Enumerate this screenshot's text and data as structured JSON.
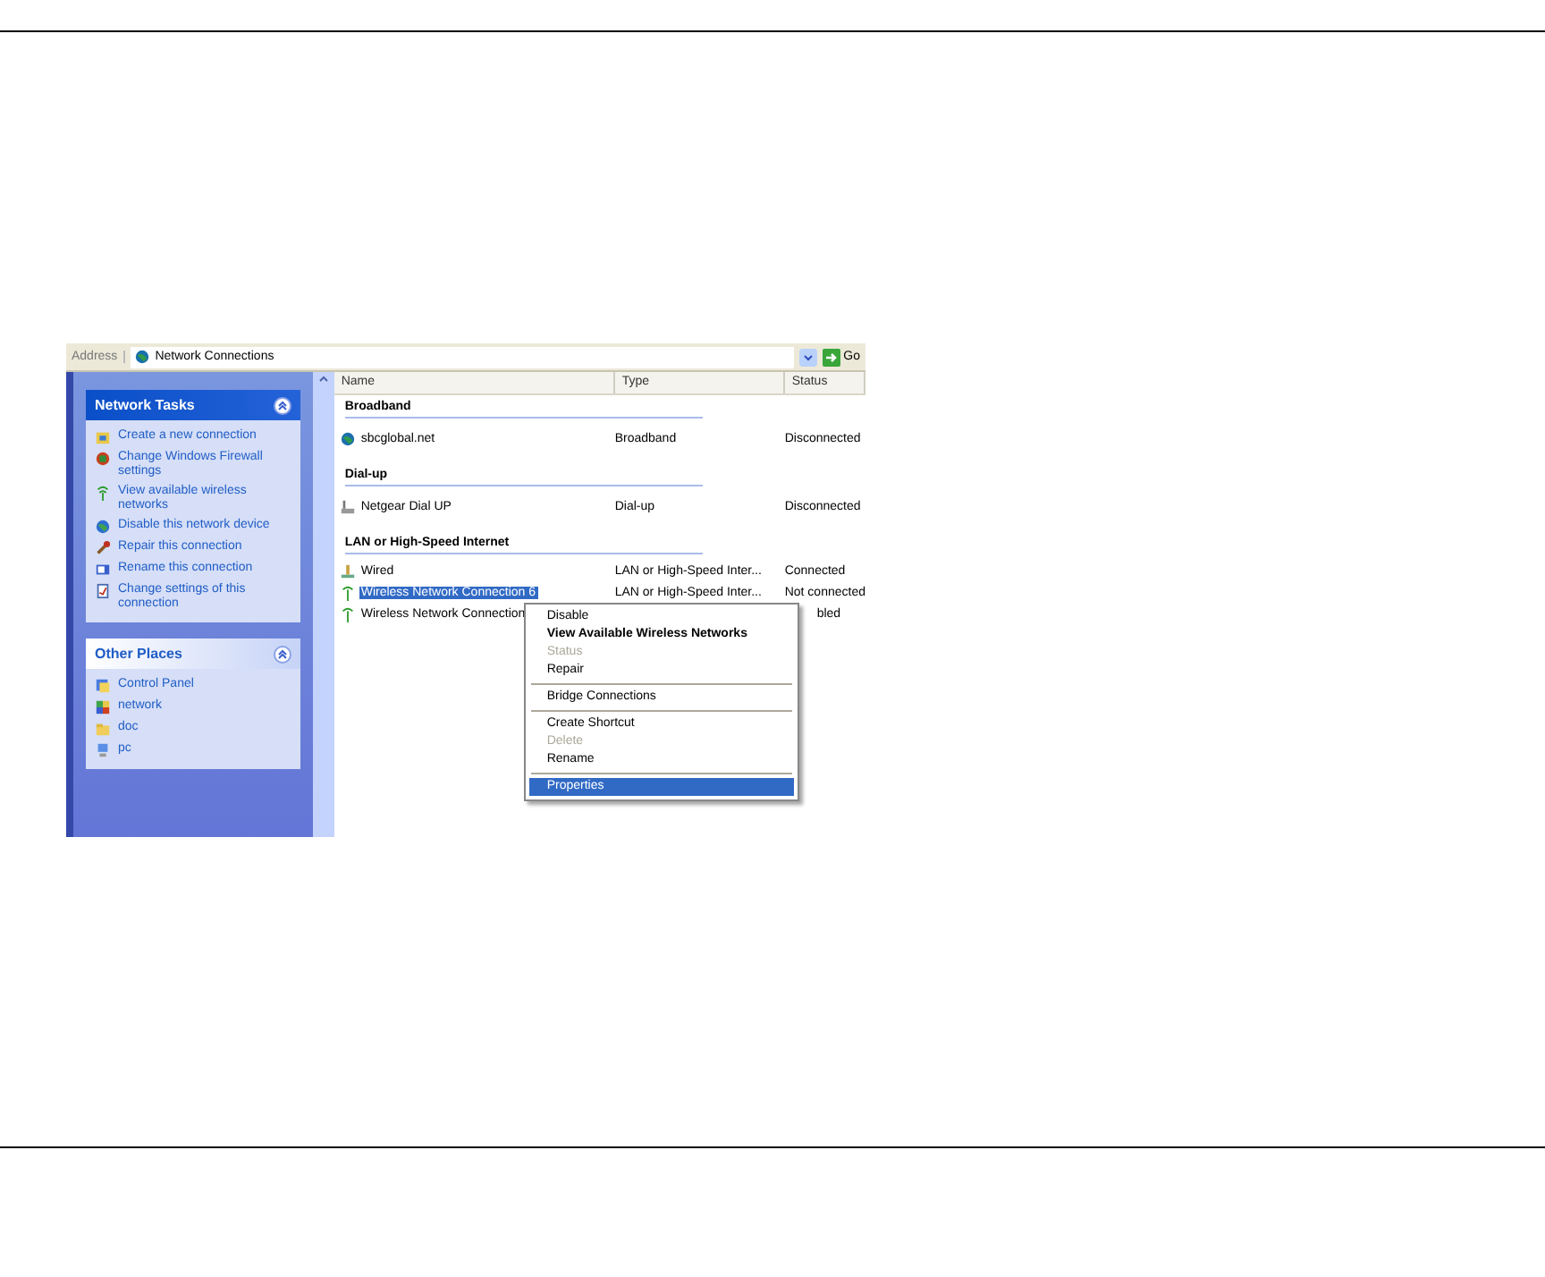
{
  "address_bar": {
    "label": "Address",
    "value": "Network Connections",
    "go": "Go"
  },
  "side_panels": [
    {
      "title": "Network Tasks",
      "items": [
        "Create a new connection",
        "Change Windows Firewall settings",
        "View available wireless networks",
        "Disable this network device",
        "Repair this connection",
        "Rename this connection",
        "Change settings of this connection"
      ]
    },
    {
      "title": "Other Places",
      "items": [
        "Control Panel",
        "network",
        "doc",
        "pc"
      ]
    }
  ],
  "columns": [
    "Name",
    "Type",
    "Status"
  ],
  "groups": [
    {
      "title": "Broadband",
      "rows": [
        {
          "name": "sbcglobal.net",
          "type": "Broadband",
          "status": "Disconnected",
          "selected": false
        }
      ]
    },
    {
      "title": "Dial-up",
      "rows": [
        {
          "name": "Netgear Dial UP",
          "type": "Dial-up",
          "status": "Disconnected",
          "selected": false
        }
      ]
    },
    {
      "title": "LAN or High-Speed Internet",
      "rows": [
        {
          "name": "Wired",
          "type": "LAN or High-Speed Inter...",
          "status": "Connected",
          "selected": false
        },
        {
          "name": "Wireless Network Connection 6",
          "type": "LAN or High-Speed Inter...",
          "status": "Not connected",
          "selected": true
        },
        {
          "name": "Wireless Network Connection",
          "status": "bled",
          "selected": false
        }
      ]
    }
  ],
  "context_menu": [
    {
      "kind": "item",
      "label": "Disable",
      "bold": false,
      "disabled": false,
      "selected": false
    },
    {
      "kind": "item",
      "label": "View Available Wireless Networks",
      "bold": true,
      "disabled": false,
      "selected": false
    },
    {
      "kind": "item",
      "label": "Status",
      "bold": false,
      "disabled": true,
      "selected": false
    },
    {
      "kind": "item",
      "label": "Repair",
      "bold": false,
      "disabled": false,
      "selected": false
    },
    {
      "kind": "separator"
    },
    {
      "kind": "item",
      "label": "Bridge Connections",
      "bold": false,
      "disabled": false,
      "selected": false
    },
    {
      "kind": "separator"
    },
    {
      "kind": "item",
      "label": "Create Shortcut",
      "bold": false,
      "disabled": false,
      "selected": false
    },
    {
      "kind": "item",
      "label": "Delete",
      "bold": false,
      "disabled": true,
      "selected": false
    },
    {
      "kind": "item",
      "label": "Rename",
      "bold": false,
      "disabled": false,
      "selected": false
    },
    {
      "kind": "separator"
    },
    {
      "kind": "item",
      "label": "Properties",
      "bold": false,
      "disabled": false,
      "selected": true
    }
  ]
}
